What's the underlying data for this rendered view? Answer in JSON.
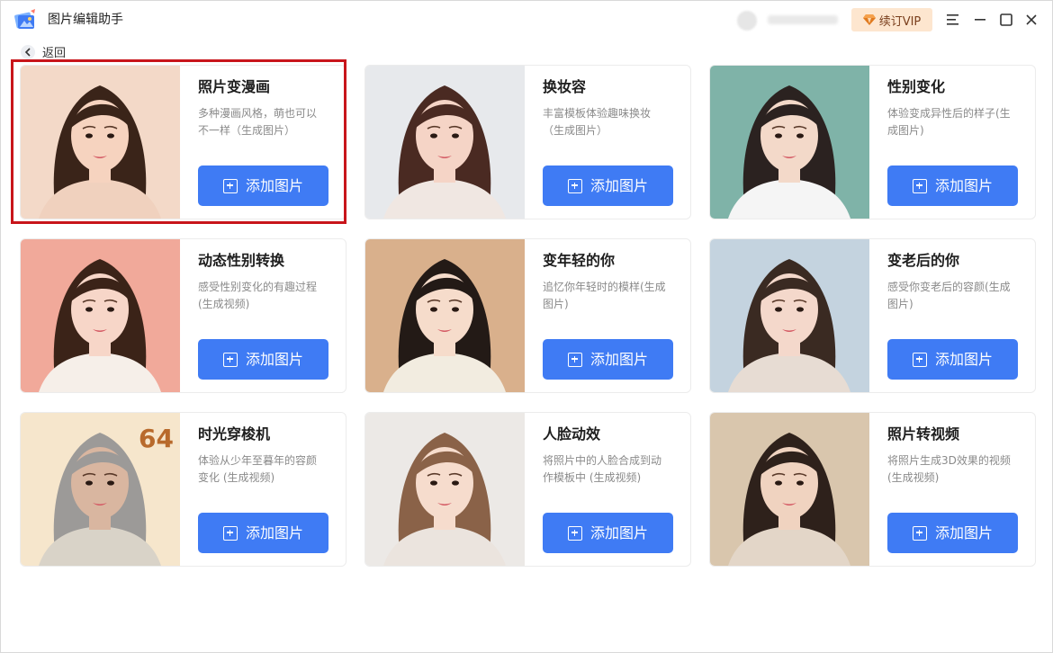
{
  "app": {
    "title": "图片编辑助手",
    "vip_label": "续订VIP"
  },
  "nav": {
    "back_label": "返回"
  },
  "cards": [
    {
      "title": "照片变漫画",
      "desc": "多种漫画风格，萌也可以不一样（生成图片）",
      "button": "添加图片",
      "bg": "#f3d9c8",
      "hair": "#3a2419",
      "skin": "#f6d3bf",
      "cloth": "#f0d1be"
    },
    {
      "title": "换妆容",
      "desc": "丰富模板体验趣味换妆（生成图片）",
      "button": "添加图片",
      "bg": "#e7e9ec",
      "hair": "#4a2a22",
      "skin": "#f5d4c6",
      "cloth": "#f0e7e2"
    },
    {
      "title": "性别变化",
      "desc": "体验变成异性后的样子(生成图片)",
      "button": "添加图片",
      "bg": "#7fb3a8",
      "hair": "#2b2220",
      "skin": "#f3d9c9",
      "cloth": "#f5f5f5"
    },
    {
      "title": "动态性别转换",
      "desc": "感受性别变化的有趣过程(生成视频)",
      "button": "添加图片",
      "bg": "#f1a99a",
      "hair": "#3b2318",
      "skin": "#f7d6c8",
      "cloth": "#f6efe9"
    },
    {
      "title": "变年轻的你",
      "desc": "追忆你年轻时的模样(生成图片)",
      "button": "添加图片",
      "bg": "#d9b08c",
      "hair": "#231a16",
      "skin": "#f6dccb",
      "cloth": "#f2ece0"
    },
    {
      "title": "变老后的你",
      "desc": "感受你变老后的容颜(生成图片)",
      "button": "添加图片",
      "bg": "#c4d3df",
      "hair": "#3a2a22",
      "skin": "#f4d8cb",
      "cloth": "#e7dcd3"
    },
    {
      "title": "时光穿梭机",
      "desc": "体验从少年至暮年的容颜变化 (生成视频)",
      "button": "添加图片",
      "bg": "#f6e6cc",
      "hair": "#9c9a98",
      "skin": "#d9b6a0",
      "cloth": "#d9d3c8",
      "badge": "64",
      "badge_color": "#b86a2c"
    },
    {
      "title": "人脸动效",
      "desc": "将照片中的人脸合成到动作模板中 (生成视频)",
      "button": "添加图片",
      "bg": "#ece9e6",
      "hair": "#8a6248",
      "skin": "#f6dccd",
      "cloth": "#ebe4de"
    },
    {
      "title": "照片转视频",
      "desc": "将照片生成3D效果的视频 (生成视频)",
      "button": "添加图片",
      "bg": "#d9c6ad",
      "hair": "#2e211b",
      "skin": "#f0d3c0",
      "cloth": "#e3d6c8"
    }
  ],
  "colors": {
    "accent": "#3f7bf4",
    "highlight": "#c8151b",
    "vip_bg": "#fde6cf"
  }
}
